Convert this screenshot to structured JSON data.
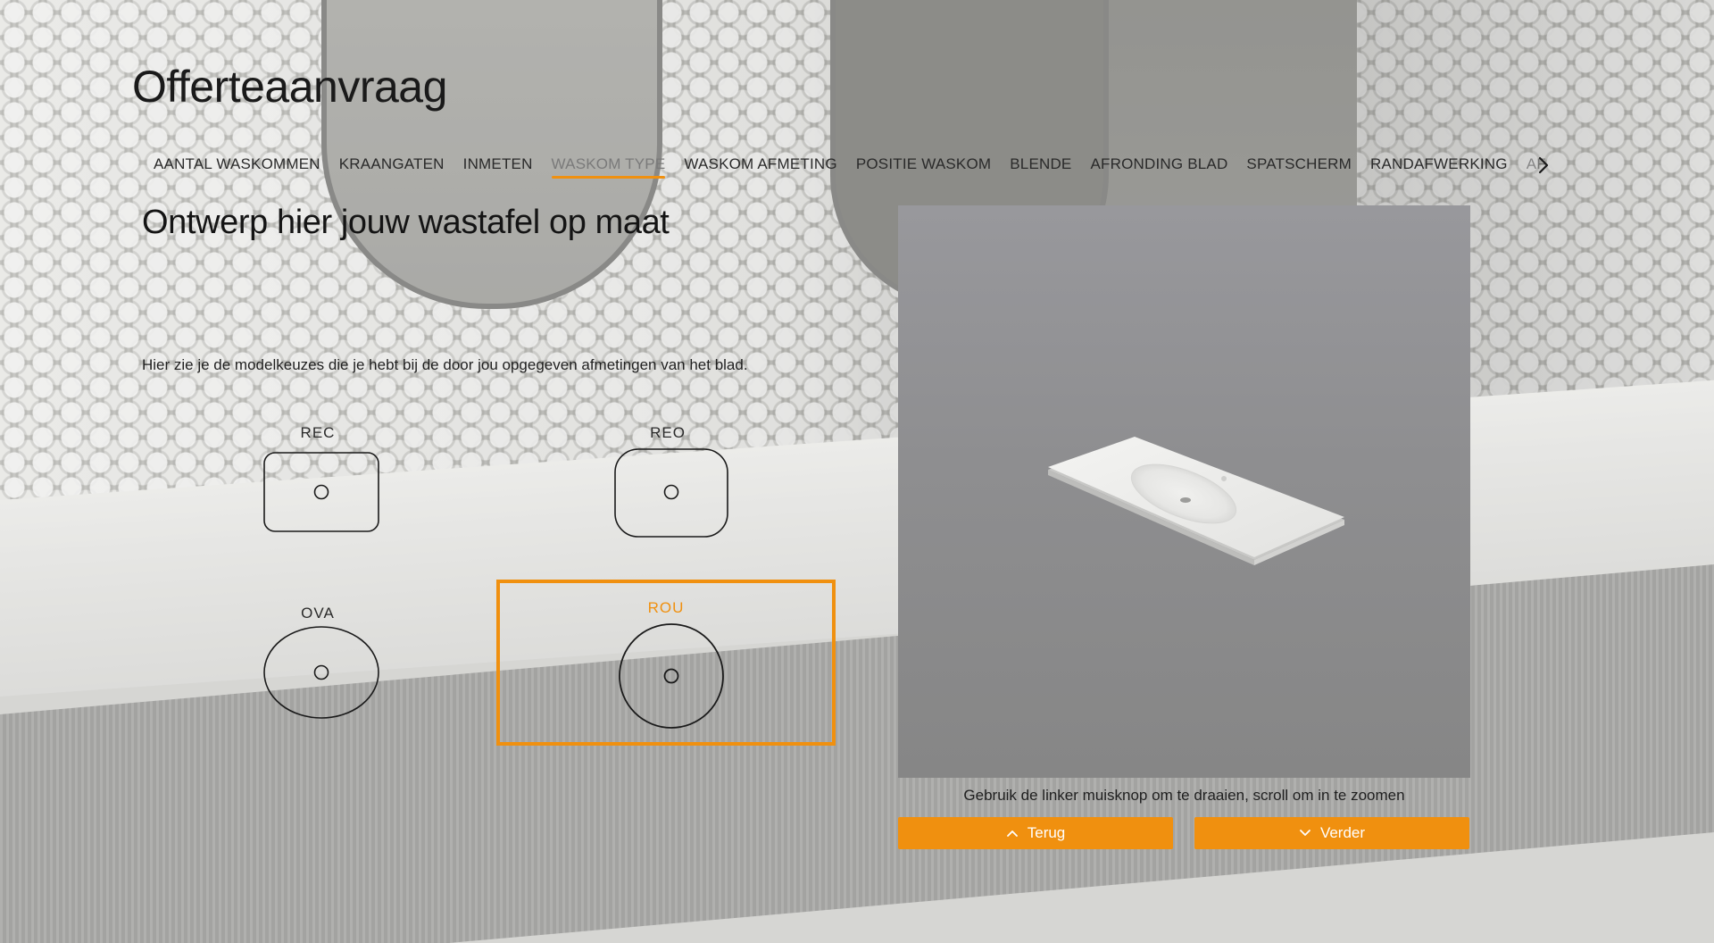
{
  "page": {
    "title": "Offerteaanvraag",
    "headline": "Ontwerp hier jouw wastafel op maat",
    "intro": "Hier zie je de modelkeuzes die je hebt bij de door jou opgegeven afmetingen van het blad."
  },
  "tabs": [
    {
      "label": "AANTAL WASKOMMEN",
      "active": false
    },
    {
      "label": "KRAANGATEN",
      "active": false
    },
    {
      "label": "INMETEN",
      "active": false
    },
    {
      "label": "WASKOM TYPE",
      "active": true
    },
    {
      "label": "WASKOM AFMETING",
      "active": false
    },
    {
      "label": "POSITIE WASKOM",
      "active": false
    },
    {
      "label": "BLENDE",
      "active": false
    },
    {
      "label": "AFRONDING BLAD",
      "active": false
    },
    {
      "label": "SPATSCHERM",
      "active": false
    },
    {
      "label": "RANDAFWERKING",
      "active": false
    },
    {
      "label": "AFW",
      "active": false
    }
  ],
  "tabs_next_icon": "chevron-right-icon",
  "options": [
    {
      "code": "REC",
      "shape": "rounded-rectangle",
      "selected": false
    },
    {
      "code": "REO",
      "shape": "rounded-rectangle-soft",
      "selected": false
    },
    {
      "code": "OVA",
      "shape": "oval",
      "selected": false
    },
    {
      "code": "ROU",
      "shape": "round",
      "selected": true
    }
  ],
  "viewer": {
    "hint": "Gebruik de linker muisknop om te draaien, scroll om in te zoomen"
  },
  "buttons": {
    "back_label": "Terug",
    "back_icon": "chevron-up-icon",
    "next_label": "Verder",
    "next_icon": "chevron-down-icon"
  },
  "colors": {
    "accent": "#f0900f",
    "viewer_bg": "#8e8e90",
    "text": "#1a1a1a"
  }
}
